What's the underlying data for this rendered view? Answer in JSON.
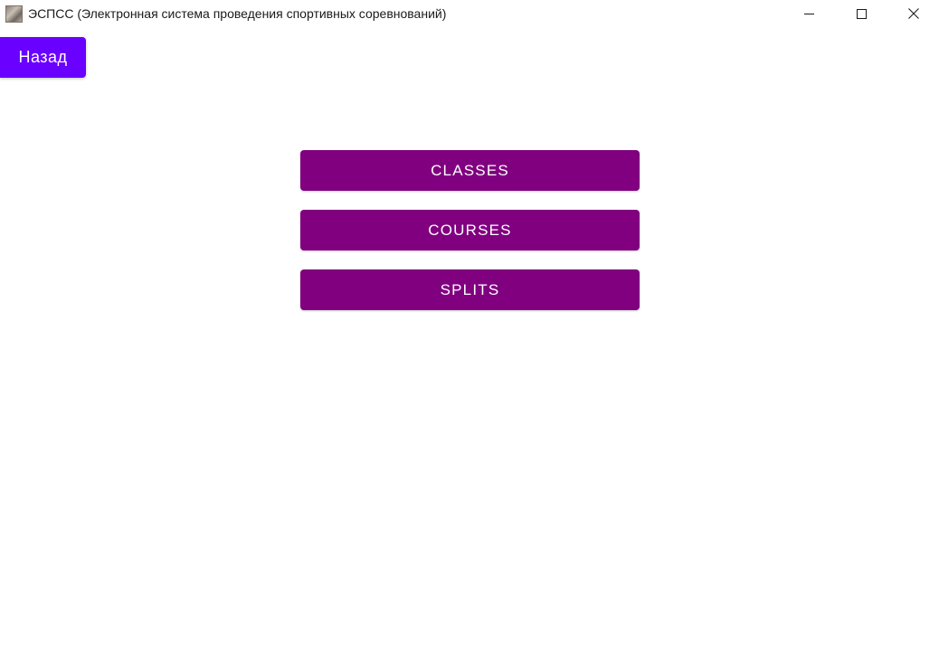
{
  "window": {
    "title": "ЭСПСС (Электронная система проведения спортивных соревнований)",
    "app_icon": "app-icon",
    "controls": {
      "minimize_icon": "minimize-icon",
      "maximize_icon": "maximize-icon",
      "close_icon": "close-icon"
    }
  },
  "toolbar": {
    "back_label": "Назад"
  },
  "menu": {
    "buttons": [
      {
        "label": "CLASSES"
      },
      {
        "label": "COURSES"
      },
      {
        "label": "SPLITS"
      }
    ]
  },
  "colors": {
    "back_button": "#6a00ff",
    "menu_button": "#800080",
    "button_text": "#ffffff"
  }
}
